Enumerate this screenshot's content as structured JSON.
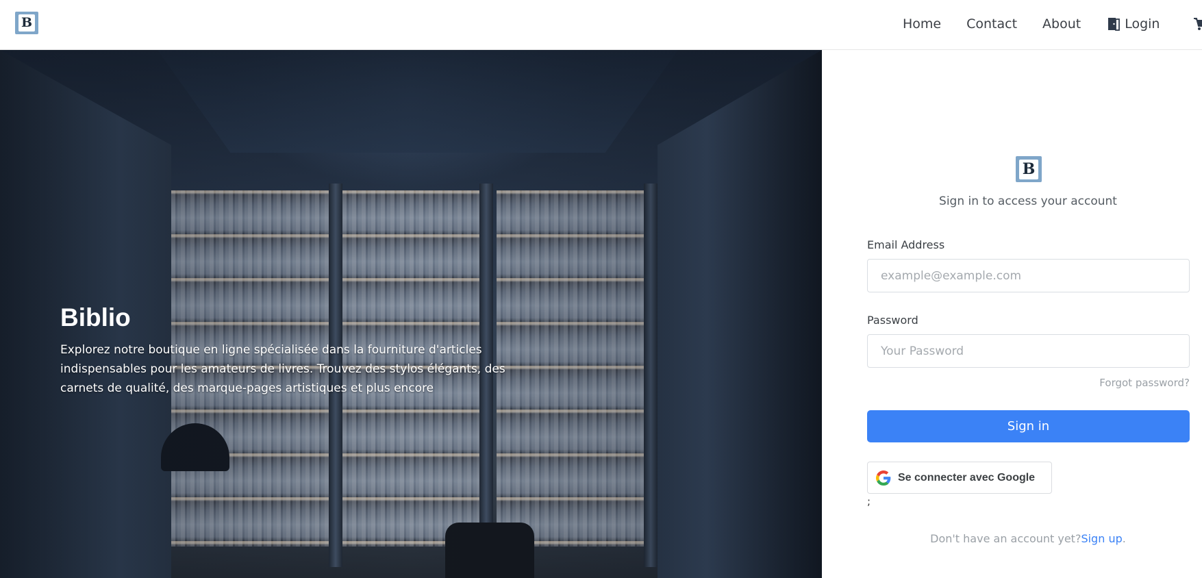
{
  "navbar": {
    "logo_letter": "B",
    "links": [
      {
        "label": "Home"
      },
      {
        "label": "Contact"
      },
      {
        "label": "About"
      },
      {
        "label": "Login",
        "icon": "door-icon"
      }
    ],
    "cart_icon": "cart-icon"
  },
  "hero": {
    "title": "Biblio",
    "description": "Explorez notre boutique en ligne spécialisée dans la fourniture d'articles indispensables pour les amateurs de livres. Trouvez des stylos élégants, des carnets de qualité, des marque-pages artistiques et plus encore"
  },
  "login": {
    "logo_letter": "B",
    "subtitle": "Sign in to access your account",
    "email_label": "Email Address",
    "email_placeholder": "example@example.com",
    "email_value": "",
    "password_label": "Password",
    "password_placeholder": "Your Password",
    "password_value": "",
    "forgot_label": "Forgot password?",
    "signin_label": "Sign in",
    "google_label": "Se connecter avec Google",
    "stray_text": ";",
    "signup_prompt": "Don't have an account yet?",
    "signup_link": "Sign up",
    "signup_suffix": ".",
    "accent_color": "#3b82f6"
  }
}
